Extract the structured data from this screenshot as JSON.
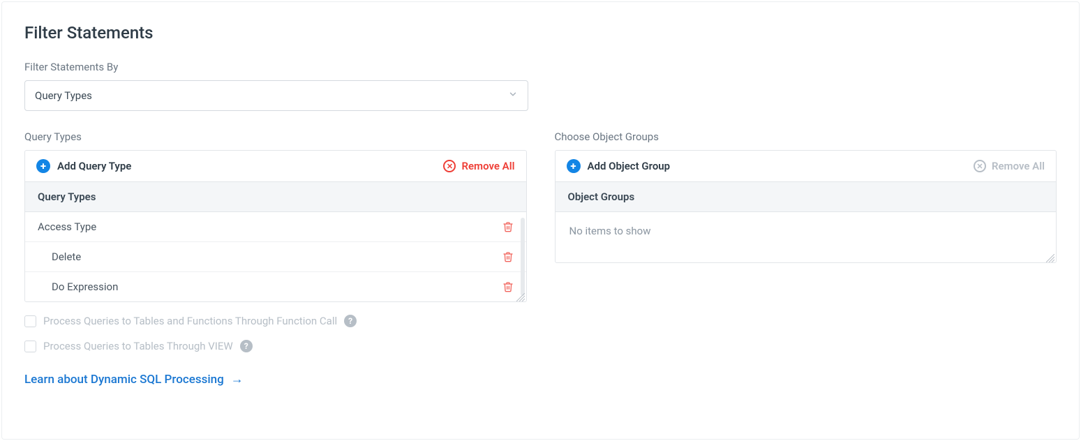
{
  "title": "Filter Statements",
  "filterByLabel": "Filter Statements By",
  "filterBySelected": "Query Types",
  "left": {
    "sectionLabel": "Query Types",
    "addLabel": "Add Query Type",
    "removeAllLabel": "Remove All",
    "listHeader": "Query Types",
    "items": [
      {
        "label": "Access Type",
        "indent": false
      },
      {
        "label": "Delete",
        "indent": true
      },
      {
        "label": "Do Expression",
        "indent": true
      }
    ]
  },
  "right": {
    "sectionLabel": "Choose Object Groups",
    "addLabel": "Add Object Group",
    "removeAllLabel": "Remove All",
    "listHeader": "Object Groups",
    "emptyText": "No items to show"
  },
  "options": {
    "opt1": "Process Queries to Tables and Functions Through Function Call",
    "opt2": "Process Queries to Tables Through VIEW"
  },
  "learnLink": "Learn about Dynamic SQL Processing"
}
